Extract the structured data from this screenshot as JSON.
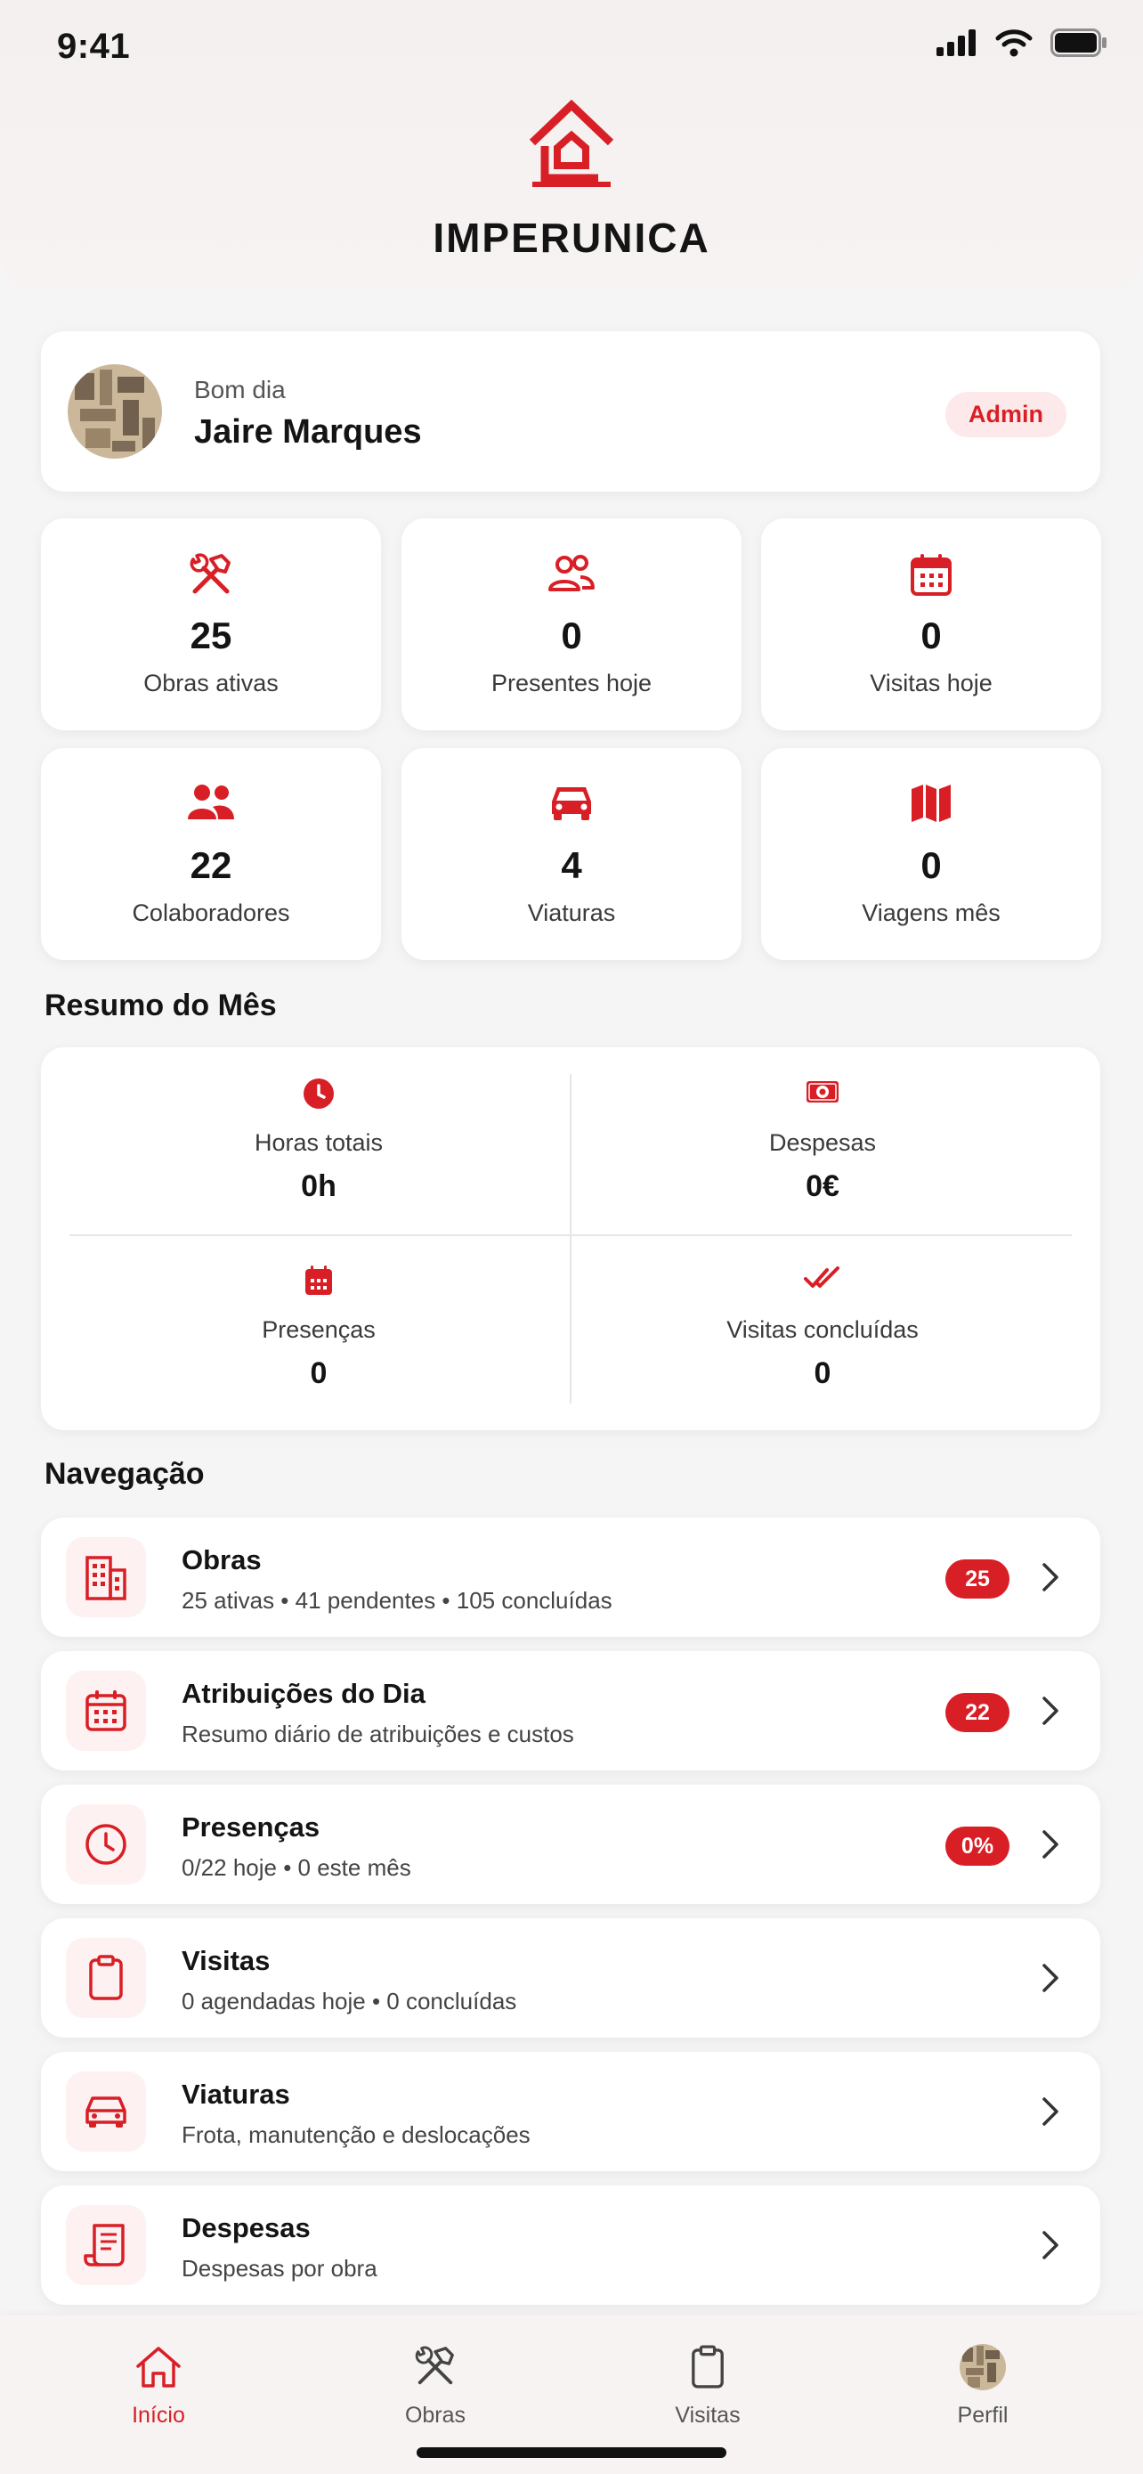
{
  "status_bar": {
    "time": "9:41"
  },
  "brand": {
    "name": "IMPERUNICA",
    "accent": "#d91f26"
  },
  "user": {
    "greeting": "Bom dia",
    "name": "Jaire Marques",
    "role": "Admin"
  },
  "stats": [
    {
      "icon": "tools-icon",
      "value": "25",
      "label": "Obras ativas"
    },
    {
      "icon": "people-outline-icon",
      "value": "0",
      "label": "Presentes hoje"
    },
    {
      "icon": "calendar-icon",
      "value": "0",
      "label": "Visitas hoje"
    },
    {
      "icon": "people-icon",
      "value": "22",
      "label": "Colaboradores"
    },
    {
      "icon": "car-icon",
      "value": "4",
      "label": "Viaturas"
    },
    {
      "icon": "map-icon",
      "value": "0",
      "label": "Viagens mês"
    }
  ],
  "summary": {
    "title": "Resumo do Mês",
    "items": [
      {
        "icon": "clock-icon",
        "label": "Horas totais",
        "value": "0h"
      },
      {
        "icon": "money-icon",
        "label": "Despesas",
        "value": "0€"
      },
      {
        "icon": "calendar-icon",
        "label": "Presenças",
        "value": "0"
      },
      {
        "icon": "double-check-icon",
        "label": "Visitas concluídas",
        "value": "0"
      }
    ]
  },
  "navigation": {
    "title": "Navegação",
    "items": [
      {
        "icon": "building-icon",
        "title": "Obras",
        "subtitle": "25 ativas • 41 pendentes • 105 concluídas",
        "badge": "25"
      },
      {
        "icon": "calendar-icon",
        "title": "Atribuições do Dia",
        "subtitle": "Resumo diário de atribuições e custos",
        "badge": "22"
      },
      {
        "icon": "clock-icon",
        "title": "Presenças",
        "subtitle": "0/22 hoje • 0 este mês",
        "badge": "0%"
      },
      {
        "icon": "clipboard-icon",
        "title": "Visitas",
        "subtitle": "0 agendadas hoje • 0 concluídas",
        "badge": ""
      },
      {
        "icon": "car-icon",
        "title": "Viaturas",
        "subtitle": "Frota, manutenção e deslocações",
        "badge": ""
      },
      {
        "icon": "receipt-icon",
        "title": "Despesas",
        "subtitle": "Despesas por obra",
        "badge": ""
      }
    ]
  },
  "tab_bar": {
    "items": [
      {
        "icon": "home-icon",
        "label": "Início",
        "active": true
      },
      {
        "icon": "tools-icon",
        "label": "Obras",
        "active": false
      },
      {
        "icon": "clipboard-icon",
        "label": "Visitas",
        "active": false
      },
      {
        "icon": "avatar",
        "label": "Perfil",
        "active": false
      }
    ]
  }
}
